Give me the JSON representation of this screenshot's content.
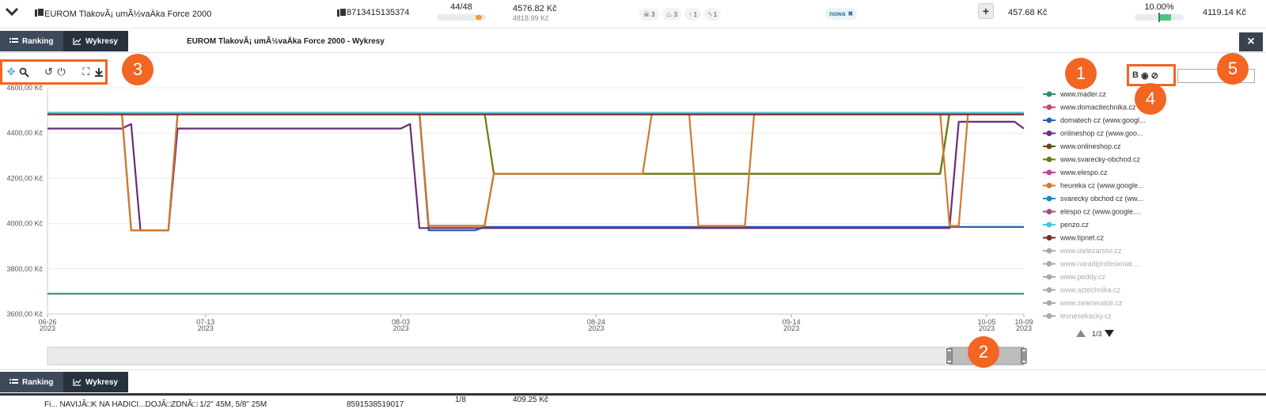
{
  "product": {
    "name": "EUROM TlakovÃ¡ umÃ½vaÄka Force 2000",
    "ean": "8713415135374",
    "rank": "44/48",
    "rank_fraction": 0.92,
    "price_main": "4576.82 Kč",
    "price_sub": "4818.99 Kč",
    "badges": [
      {
        "icon": "skull-icon",
        "value": "3"
      },
      {
        "icon": "fire-icon",
        "value": "3"
      },
      {
        "icon": "arrow-up-icon",
        "value": "1"
      },
      {
        "icon": "bolt-icon",
        "value": "1"
      }
    ],
    "tag": "nowa",
    "plus": "+",
    "min_price": "457.68 Kč",
    "percent": "10.00%",
    "percent_value": 10.0,
    "last_price": "4119.14 Kč"
  },
  "panel": {
    "tab_ranking": "Ranking",
    "tab_wykresy": "Wykresy",
    "title": "EUROM TlakovÃ¡ umÃ½vaÄka Force 2000 - Wykresy",
    "close": "×",
    "right_label": "B"
  },
  "callouts": [
    "1",
    "2",
    "3",
    "4",
    "5"
  ],
  "chart_data": {
    "type": "line",
    "y_ticks": [
      "3600,00 Kč",
      "3800,00 Kč",
      "4000,00 Kč",
      "4200,00 Kč",
      "4400,00 Kč",
      "4600,00 Kč"
    ],
    "ylim": [
      3600,
      4600
    ],
    "x_ticks": [
      {
        "date": "2023-06-26",
        "label": "06-26",
        "year": "2023"
      },
      {
        "date": "2023-07-13",
        "label": "07-13",
        "year": "2023"
      },
      {
        "date": "2023-08-03",
        "label": "08-03",
        "year": "2023"
      },
      {
        "date": "2023-08-24",
        "label": "08-24",
        "year": "2023"
      },
      {
        "date": "2023-09-14",
        "label": "09-14",
        "year": "2023"
      },
      {
        "date": "2023-10-05",
        "label": "10-05",
        "year": "2023"
      },
      {
        "date": "2023-10-09",
        "label": "10-09",
        "year": "2023"
      }
    ],
    "xlim": [
      "2023-06-26",
      "2023-10-09"
    ],
    "series": [
      {
        "name": "www.mader.cz",
        "color": "#2e8b7a",
        "active": true,
        "points": [
          [
            "2023-06-26",
            3690
          ],
          [
            "2023-10-09",
            3690
          ]
        ]
      },
      {
        "name": "www.domacitechnika.cz",
        "color": "#c94a6a",
        "active": true,
        "points": [
          [
            "2023-06-26",
            4488
          ],
          [
            "2023-10-09",
            4488
          ]
        ]
      },
      {
        "name": "domatech cz (www.googl...",
        "color": "#2f5fb5",
        "active": true,
        "points": [
          [
            "2023-06-26",
            4488
          ],
          [
            "2023-08-05",
            4488
          ],
          [
            "2023-08-06",
            3970
          ],
          [
            "2023-08-11",
            3970
          ],
          [
            "2023-08-12",
            3985
          ],
          [
            "2023-10-09",
            3985
          ]
        ]
      },
      {
        "name": "onlineshop cz (www.goo...",
        "color": "#6a2c7a",
        "active": true,
        "points": [
          [
            "2023-06-26",
            4420
          ],
          [
            "2023-07-04",
            4420
          ],
          [
            "2023-07-05",
            4440
          ],
          [
            "2023-07-06",
            3970
          ],
          [
            "2023-07-09",
            3970
          ],
          [
            "2023-07-10",
            4420
          ],
          [
            "2023-08-03",
            4420
          ],
          [
            "2023-08-04",
            4440
          ],
          [
            "2023-08-05",
            3980
          ],
          [
            "2023-10-01",
            3980
          ],
          [
            "2023-10-02",
            4450
          ],
          [
            "2023-10-08",
            4450
          ],
          [
            "2023-10-09",
            4420
          ]
        ]
      },
      {
        "name": "www.onlineshop.cz",
        "color": "#6b4a10",
        "active": true,
        "points": [
          [
            "2023-06-26",
            4488
          ],
          [
            "2023-07-04",
            4488
          ],
          [
            "2023-07-05",
            3970
          ],
          [
            "2023-07-09",
            3970
          ],
          [
            "2023-07-10",
            4488
          ],
          [
            "2023-08-05",
            4488
          ],
          [
            "2023-08-06",
            3990
          ],
          [
            "2023-08-12",
            3990
          ],
          [
            "2023-08-13",
            4220
          ],
          [
            "2023-09-30",
            4220
          ],
          [
            "2023-10-01",
            4488
          ],
          [
            "2023-10-09",
            4488
          ]
        ]
      },
      {
        "name": "www.svarecky-obchod.cz",
        "color": "#6b7a10",
        "active": true,
        "points": [
          [
            "2023-06-26",
            4488
          ],
          [
            "2023-08-12",
            4488
          ],
          [
            "2023-08-13",
            4220
          ],
          [
            "2023-09-30",
            4220
          ],
          [
            "2023-10-01",
            4488
          ],
          [
            "2023-10-09",
            4488
          ]
        ]
      },
      {
        "name": "www.elespo.cz",
        "color": "#c2448e",
        "active": true,
        "points": [
          [
            "2023-06-26",
            4488
          ],
          [
            "2023-10-09",
            4488
          ]
        ]
      },
      {
        "name": "heureka cz (www.google...",
        "color": "#d07a30",
        "active": true,
        "points": [
          [
            "2023-06-26",
            4488
          ],
          [
            "2023-07-04",
            4488
          ],
          [
            "2023-07-05",
            3970
          ],
          [
            "2023-07-09",
            3970
          ],
          [
            "2023-07-10",
            4488
          ],
          [
            "2023-08-05",
            4488
          ],
          [
            "2023-08-06",
            3990
          ],
          [
            "2023-08-12",
            3990
          ],
          [
            "2023-08-13",
            4220
          ],
          [
            "2023-08-24",
            4220
          ],
          [
            "2023-08-29",
            4220
          ],
          [
            "2023-08-30",
            4488
          ],
          [
            "2023-09-03",
            4488
          ],
          [
            "2023-09-04",
            3990
          ],
          [
            "2023-09-09",
            3990
          ],
          [
            "2023-09-10",
            4488
          ],
          [
            "2023-09-30",
            4488
          ],
          [
            "2023-10-01",
            3990
          ],
          [
            "2023-10-02",
            3990
          ],
          [
            "2023-10-03",
            4488
          ],
          [
            "2023-10-09",
            4488
          ]
        ]
      },
      {
        "name": "svarecky obchod cz (ww...",
        "color": "#1f8ac0",
        "active": true,
        "points": [
          [
            "2023-06-26",
            4488
          ],
          [
            "2023-10-09",
            4488
          ]
        ]
      },
      {
        "name": "elespo cz (www.google....",
        "color": "#a04a8a",
        "active": true,
        "points": [
          [
            "2023-06-26",
            4488
          ],
          [
            "2023-10-09",
            4488
          ]
        ]
      },
      {
        "name": "penzo.cz",
        "color": "#3ec8e8",
        "active": true,
        "points": [
          [
            "2023-06-26",
            4488
          ],
          [
            "2023-10-09",
            4488
          ]
        ]
      },
      {
        "name": "www.tipnet.cz",
        "color": "#7a2a2a",
        "active": true,
        "points": [
          [
            "2023-06-26",
            4482
          ],
          [
            "2023-10-09",
            4482
          ]
        ]
      },
      {
        "name": "www.izelezarstvi.cz",
        "color": "#999999",
        "active": false,
        "points": []
      },
      {
        "name": "www.naradiprofesional....",
        "color": "#999999",
        "active": false,
        "points": []
      },
      {
        "name": "www.peddy.cz",
        "color": "#999999",
        "active": false,
        "points": []
      },
      {
        "name": "www.aztechnika.cz",
        "color": "#999999",
        "active": false,
        "points": []
      },
      {
        "name": "www.zeleneudoli.cz",
        "color": "#999999",
        "active": false,
        "points": []
      },
      {
        "name": "levnesekacky.cz",
        "color": "#999999",
        "active": false,
        "points": []
      }
    ],
    "legend_page": "1/3",
    "navigator_range": [
      "2023-10-01",
      "2023-10-09"
    ],
    "grid": true,
    "legend_position": "right"
  },
  "bottom": {
    "tab_ranking": "Ranking",
    "tab_wykresy": "Wykresy"
  },
  "next_product": {
    "name": "Fi... NAVIJÃ□K NA HADICI...DOJÃ□ZDNÃ□ 1/2\" 45M, 5/8\" 25M",
    "ean": "8591538519017",
    "rank": "1/8",
    "price": "409.25 Kč"
  }
}
